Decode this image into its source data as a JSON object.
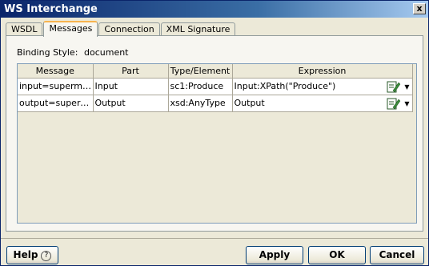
{
  "window": {
    "title": "WS Interchange",
    "close_label": "x"
  },
  "tabs": [
    {
      "label": "WSDL"
    },
    {
      "label": "Messages",
      "active": true
    },
    {
      "label": "Connection"
    },
    {
      "label": "XML Signature"
    }
  ],
  "binding": {
    "label": "Binding Style:",
    "value": "document"
  },
  "table": {
    "columns": [
      "Message",
      "Part",
      "Type/Element",
      "Expression"
    ],
    "rows": [
      {
        "message": "input=supermark...",
        "part": "Input",
        "type": "sc1:Produce",
        "expression": "Input:XPath(\"Produce\")"
      },
      {
        "message": "output=supermar...",
        "part": "Output",
        "type": "xsd:AnyType",
        "expression": "Output"
      }
    ]
  },
  "buttons": {
    "help": "Help",
    "help_icon": "?",
    "apply": "Apply",
    "ok": "OK",
    "cancel": "Cancel"
  }
}
